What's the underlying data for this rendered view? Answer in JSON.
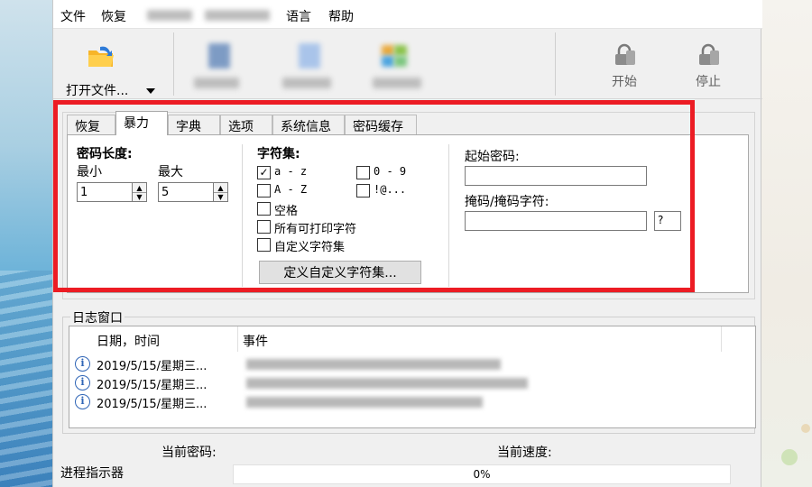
{
  "menu": {
    "file": "文件",
    "recover": "恢复",
    "language": "语言",
    "help": "帮助"
  },
  "toolbar": {
    "open_label": "打开文件...",
    "start_label": "开始",
    "stop_label": "停止"
  },
  "tabs": [
    {
      "label": "恢复"
    },
    {
      "label": "暴力"
    },
    {
      "label": "字典"
    },
    {
      "label": "选项"
    },
    {
      "label": "系统信息"
    },
    {
      "label": "密码缓存"
    }
  ],
  "active_tab": "暴力",
  "brute": {
    "length_title": "密码长度:",
    "min_label": "最小",
    "max_label": "最大",
    "min_value": "1",
    "max_value": "5",
    "charset_title": "字符集:",
    "charset": {
      "az": {
        "label": "a - z",
        "checked": true
      },
      "d09": {
        "label": "0 - 9",
        "checked": false
      },
      "AZ": {
        "label": "A - Z",
        "checked": false
      },
      "sym": {
        "label": "!@...",
        "checked": false
      },
      "space": {
        "label": "空格",
        "checked": false
      },
      "printable": {
        "label": "所有可打印字符",
        "checked": false
      },
      "custom": {
        "label": "自定义字符集",
        "checked": false
      }
    },
    "define_button": "定义自定义字符集...",
    "start_pw_label": "起始密码:",
    "start_pw_value": "",
    "mask_label": "掩码/掩码字符:",
    "mask_value": "",
    "mask_char": "?"
  },
  "log": {
    "title": "日志窗口",
    "col_date": "日期，时间",
    "col_event": "事件",
    "rows": [
      {
        "date": "2019/5/15/星期三..."
      },
      {
        "date": "2019/5/15/星期三..."
      },
      {
        "date": "2019/5/15/星期三..."
      }
    ]
  },
  "status": {
    "current_password_label": "当前密码:",
    "current_speed_label": "当前速度:",
    "progress_label": "进程指示器",
    "progress_percent": 0,
    "progress_text": "0%"
  },
  "colors": {
    "highlight": "#ec1c24",
    "info_icon": "#2f65b6"
  }
}
